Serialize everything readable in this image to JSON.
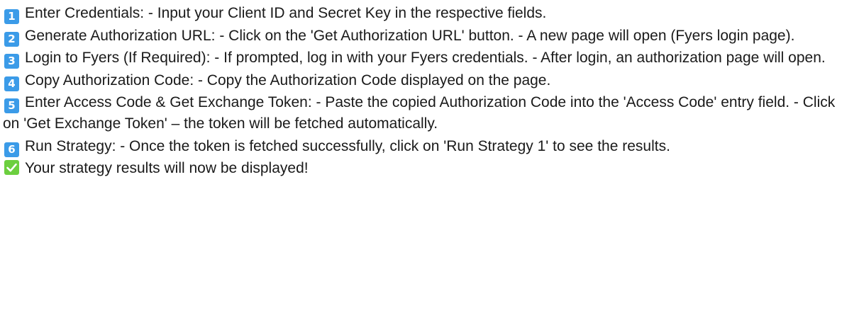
{
  "steps": [
    {
      "number": "1",
      "text": "Enter Credentials: - Input your Client ID and Secret Key in the respective fields."
    },
    {
      "number": "2",
      "text": "Generate Authorization URL: - Click on the 'Get Authorization URL' button. - A new page will open (Fyers login page)."
    },
    {
      "number": "3",
      "text": "Login to Fyers (If Required): - If prompted, log in with your Fyers credentials. - After login, an authorization page will open."
    },
    {
      "number": "4",
      "text": "Copy Authorization Code: - Copy the Authorization Code displayed on the page."
    },
    {
      "number": "5",
      "text": "Enter Access Code & Get Exchange Token: - Paste the copied Authorization Code into the 'Access Code' entry field. - Click on 'Get Exchange Token' – the token will be fetched automatically."
    },
    {
      "number": "6",
      "text": "Run Strategy: - Once the token is fetched successfully, click on 'Run Strategy 1' to see the results."
    }
  ],
  "final_note": {
    "icon": "check-mark-icon",
    "text": "Your strategy results will now be displayed!"
  },
  "colors": {
    "badge": "#3b9be8",
    "check": "#6ccf3f",
    "text": "#1a1a1a"
  }
}
